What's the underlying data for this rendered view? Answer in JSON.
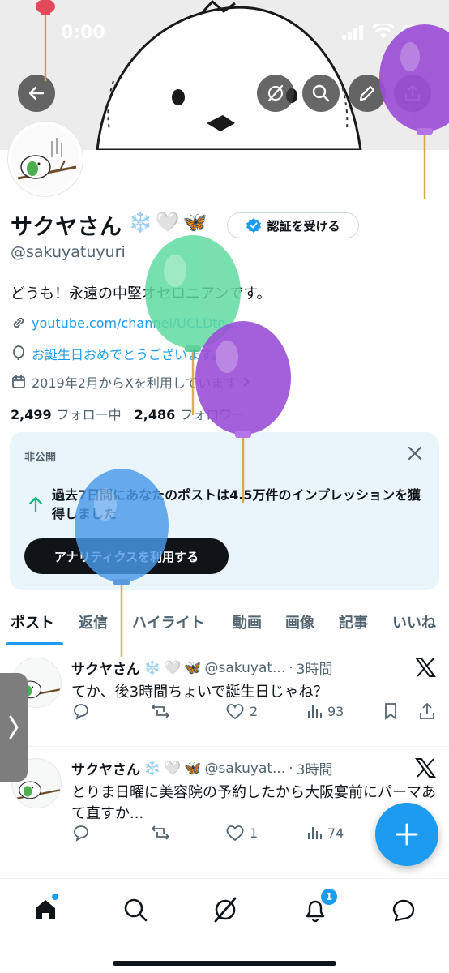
{
  "status_bar": {
    "time": "0:00"
  },
  "header_actions": [
    "back-icon",
    "grok-icon",
    "search-icon",
    "edit-icon",
    "share-icon"
  ],
  "profile": {
    "display_name": "サクヤさん",
    "name_emojis": [
      "❄️",
      "🤍",
      "🦋"
    ],
    "verify_label": "認証を受ける",
    "handle": "@sakuyatuyuri",
    "bio": "どうも！永遠の中堅オセロニアンです。",
    "link": "youtube.com/channel/UCLDtq...",
    "birthday_note": "お誕生日おめでとうございます。",
    "joined": "2019年2月からXを利用しています",
    "following_count": "2,499",
    "following_label": "フォロー中",
    "followers_count": "2,486",
    "followers_label": "フォロワー"
  },
  "private_card": {
    "label": "非公開",
    "message": "過去7日間にあなたのポストは4.5万件のインプレッションを獲得しました",
    "button": "アナリティクスを利用する"
  },
  "tabs": [
    {
      "label": "ポスト",
      "active": true
    },
    {
      "label": "返信",
      "active": false
    },
    {
      "label": "ハイライト",
      "active": false
    },
    {
      "label": "動画",
      "active": false
    },
    {
      "label": "画像",
      "active": false
    },
    {
      "label": "記事",
      "active": false
    },
    {
      "label": "いいね",
      "active": false
    }
  ],
  "tweets": [
    {
      "name": "サクヤさん",
      "handle": "@sakuyat...",
      "time": "3時間",
      "text": "てか、後3時間ちょいで誕生日じゃね？",
      "replies": "",
      "retweets": "",
      "likes": "2",
      "views": "93"
    },
    {
      "name": "サクヤさん",
      "handle": "@sakuyat...",
      "time": "3時間",
      "text": "とりま日曜に美容院の予約したから大阪宴前にパーマあて直すか...",
      "replies": "",
      "retweets": "",
      "likes": "1",
      "views": "74"
    }
  ],
  "nav": {
    "notifications_badge": "1"
  },
  "colors": {
    "accent": "#1d9bf0",
    "text": "#0f1419",
    "muted": "#536471",
    "balloon_purple": "#9b4fd6",
    "balloon_green": "#5fdba0",
    "balloon_blue": "#4a9bea"
  }
}
